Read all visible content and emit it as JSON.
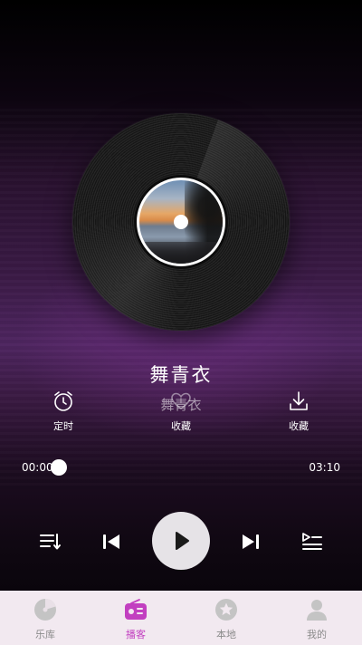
{
  "player": {
    "song_title": "舞青衣",
    "song_title_subtitle": "舞青衣",
    "current_time": "00:00",
    "total_time": "03:10",
    "progress": 0.0,
    "is_playing": false
  },
  "actions": {
    "timer_label": "定时",
    "favorite_label": "收藏",
    "download_label": "收藏"
  },
  "icons": {
    "timer": "alarm-clock-icon",
    "favorite": "heart-icon",
    "download": "download-icon",
    "playlist": "playlist-icon",
    "previous": "skip-previous-icon",
    "play": "play-icon",
    "next": "skip-next-icon",
    "queue": "queue-icon"
  },
  "nav": {
    "items": [
      {
        "label": "乐库",
        "icon": "music-disc-icon",
        "active": false
      },
      {
        "label": "播客",
        "icon": "radio-icon",
        "active": true
      },
      {
        "label": "本地",
        "icon": "star-icon",
        "active": false
      },
      {
        "label": "我的",
        "icon": "person-icon",
        "active": false
      }
    ]
  },
  "colors": {
    "accent": "#c23fc0",
    "nav_background": "#f2e9f0",
    "nav_inactive": "#c4c4c4",
    "play_button": "#e6e3e7"
  }
}
